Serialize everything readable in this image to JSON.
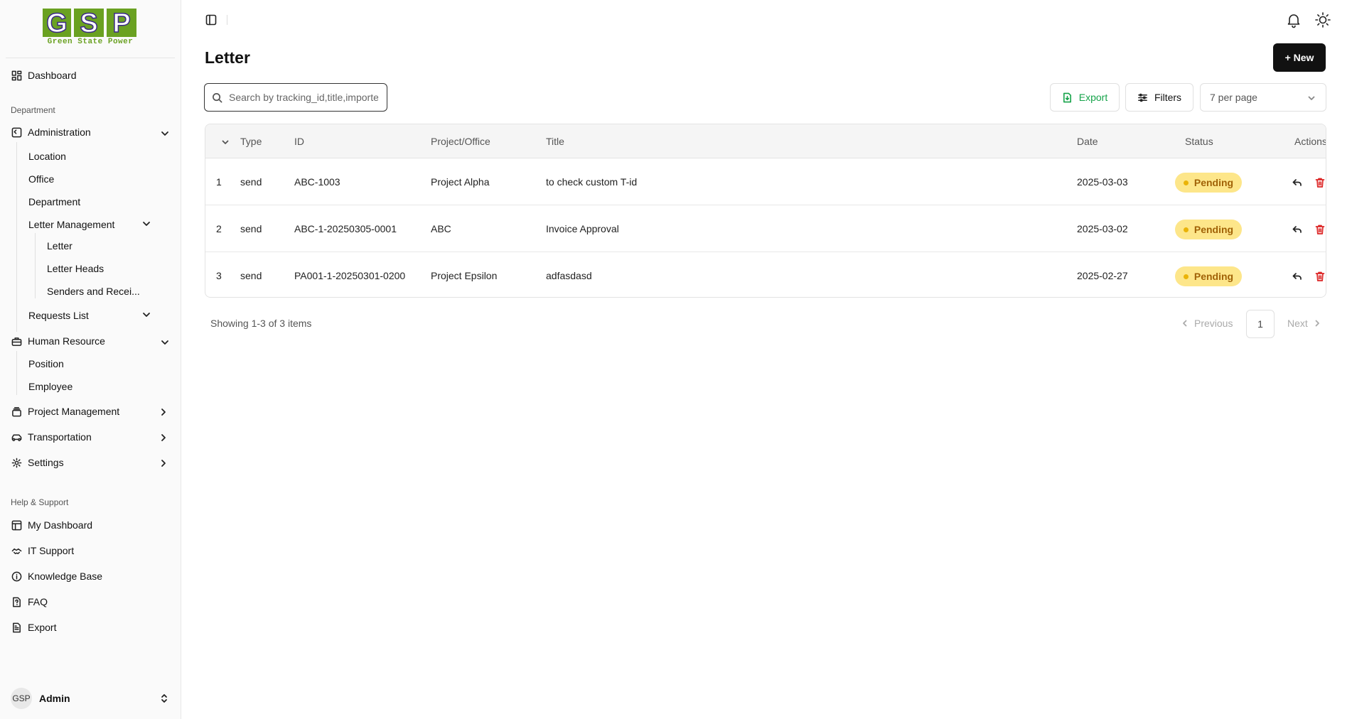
{
  "logo": {
    "letters": "GSP",
    "tagline": "Green State Power"
  },
  "sidebar": {
    "dashboard": "Dashboard",
    "department_label": "Department",
    "administration": "Administration",
    "admin_items": [
      "Location",
      "Office",
      "Department"
    ],
    "letter_management": "Letter Management",
    "letter_items": [
      "Letter",
      "Letter Heads",
      "Senders and Recei..."
    ],
    "requests_list": "Requests List",
    "human_resource": "Human Resource",
    "hr_items": [
      "Position",
      "Employee"
    ],
    "project_management": "Project Management",
    "transportation": "Transportation",
    "settings": "Settings",
    "help_label": "Help & Support",
    "help_items": [
      "My Dashboard",
      "IT Support",
      "Knowledge Base",
      "FAQ",
      "Export"
    ],
    "user": {
      "initials": "GSP",
      "name": "Admin"
    }
  },
  "page": {
    "title": "Letter",
    "new_button": "+ New",
    "search_placeholder": "Search by tracking_id,title,importe",
    "export_button": "Export",
    "filters_button": "Filters",
    "per_page": "7 per page"
  },
  "table": {
    "columns": [
      "Type",
      "ID",
      "Project/Office",
      "Title",
      "Date",
      "Status",
      "Actions"
    ],
    "rows": [
      {
        "num": "1",
        "type": "send",
        "id": "ABC-1003",
        "project": "Project Alpha",
        "title": "to check custom T-id",
        "date": "2025-03-03",
        "status": "Pending"
      },
      {
        "num": "2",
        "type": "send",
        "id": "ABC-1-20250305-0001",
        "project": "ABC",
        "title": "Invoice Approval",
        "date": "2025-03-02",
        "status": "Pending"
      },
      {
        "num": "3",
        "type": "send",
        "id": "PA001-1-20250301-0200",
        "project": "Project Epsilon",
        "title": "adfasdasd",
        "date": "2025-02-27",
        "status": "Pending"
      }
    ]
  },
  "pagination": {
    "showing": "Showing 1-3 of 3 items",
    "previous": "Previous",
    "page": "1",
    "next": "Next"
  },
  "colors": {
    "logo_green": "#6aa121",
    "logo_purple": "#3b2a86",
    "primary_button": "#111111",
    "export_green": "#16a34a",
    "pending_badge_bg": "#fde68a",
    "pending_badge_text": "#a16207",
    "delete_red": "#dc2626"
  }
}
